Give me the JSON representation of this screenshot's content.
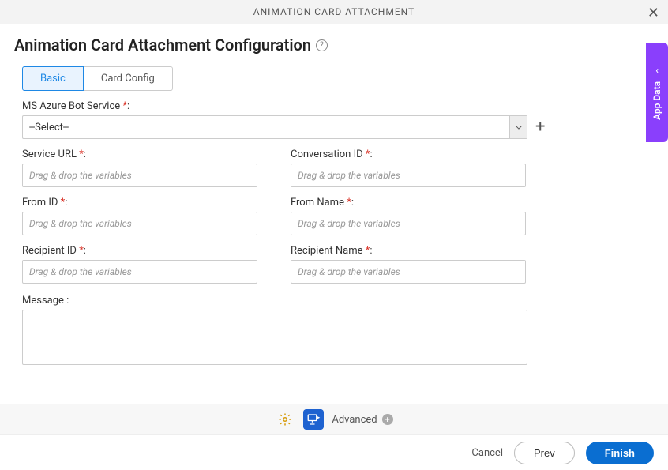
{
  "header": {
    "title": "ANIMATION CARD ATTACHMENT"
  },
  "page": {
    "title": "Animation Card Attachment Configuration"
  },
  "tabs": {
    "basic": "Basic",
    "card_config": "Card Config"
  },
  "form": {
    "azure_label": "MS Azure Bot Service ",
    "azure_select_value": "--Select--",
    "service_url_label": "Service URL ",
    "conversation_id_label": "Conversation ID ",
    "from_id_label": "From ID ",
    "from_name_label": "From Name ",
    "recipient_id_label": "Recipient ID ",
    "recipient_name_label": "Recipient Name ",
    "message_label": "Message :",
    "placeholder": "Drag & drop the variables",
    "asterisk": "*",
    "colon": ":"
  },
  "toolbar": {
    "advanced": "Advanced"
  },
  "footer": {
    "cancel": "Cancel",
    "prev": "Prev",
    "finish": "Finish"
  },
  "side": {
    "label": "App Data"
  }
}
